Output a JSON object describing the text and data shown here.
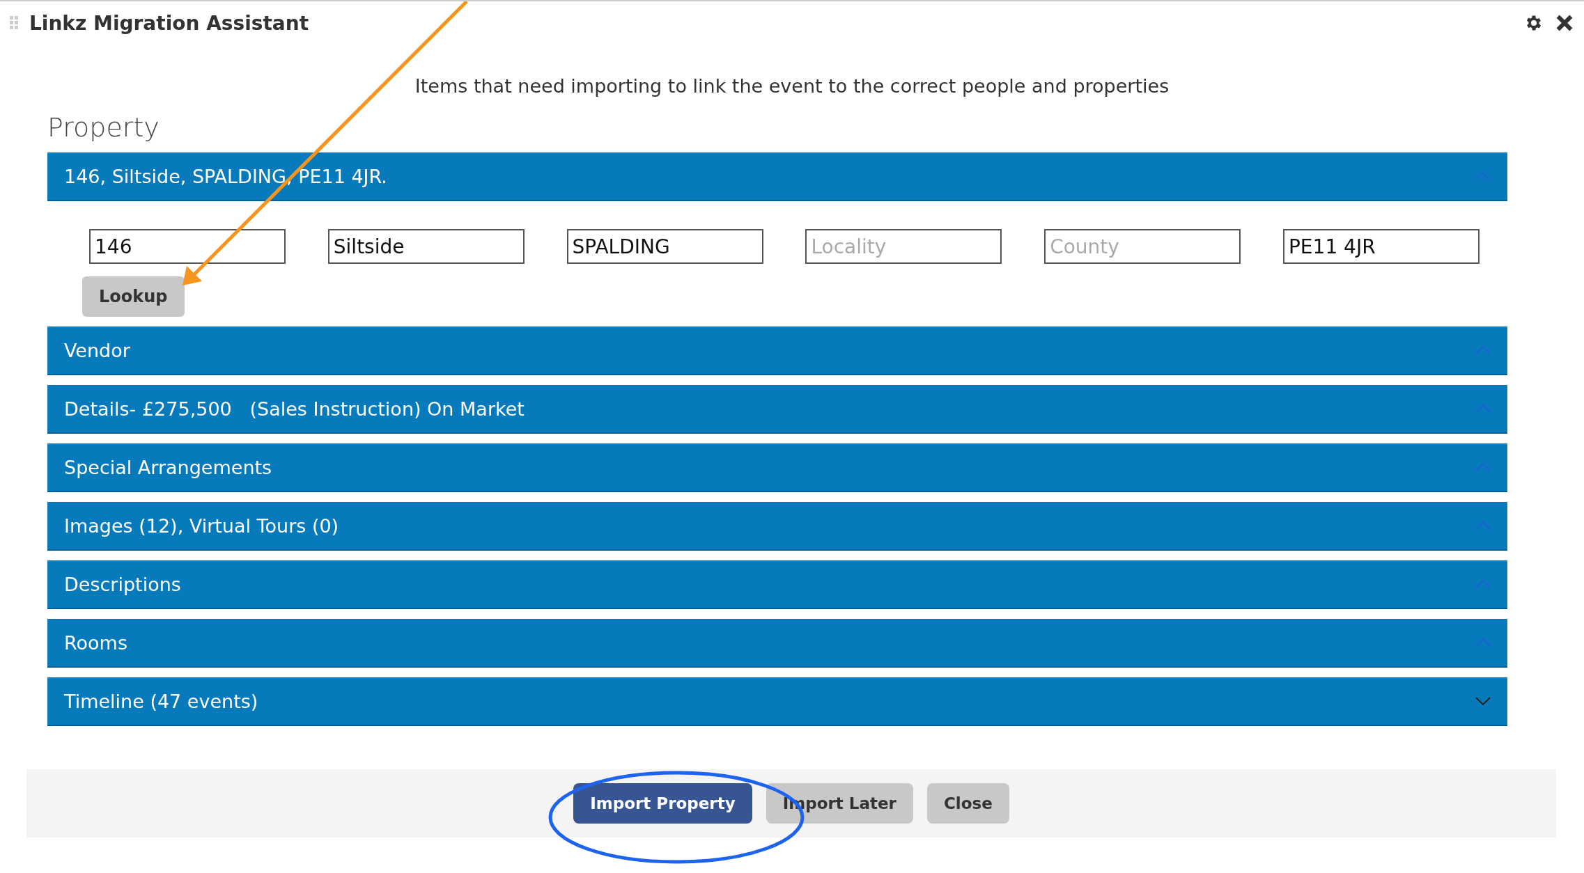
{
  "window": {
    "title": "Linkz Migration Assistant"
  },
  "intro": "Items that need importing to link the event to the correct people and properties",
  "section_title": "Property",
  "sections": [
    {
      "title": "146, Siltside, SPALDING, PE11 4JR.",
      "expanded": true,
      "fields": [
        {
          "value": "146"
        },
        {
          "value": "Siltside"
        },
        {
          "value": "SPALDING"
        },
        {
          "placeholder": "Locality"
        },
        {
          "placeholder": "County"
        },
        {
          "value": "PE11 4JR"
        }
      ],
      "button": "Lookup"
    },
    {
      "title": "Vendor",
      "expanded": true
    },
    {
      "title": "Details- £275,500   (Sales Instruction) On Market",
      "expanded": true
    },
    {
      "title": "Special Arrangements",
      "expanded": true
    },
    {
      "title": "Images (12), Virtual Tours (0)",
      "expanded": true
    },
    {
      "title": "Descriptions",
      "expanded": true
    },
    {
      "title": "Rooms",
      "expanded": true
    },
    {
      "title": "Timeline (47 events)",
      "expanded": false
    }
  ],
  "footer_buttons": [
    {
      "label": "Import Property",
      "kind": "primary"
    },
    {
      "label": "Import Later",
      "kind": "secondary"
    },
    {
      "label": "Close",
      "kind": "secondary"
    }
  ]
}
